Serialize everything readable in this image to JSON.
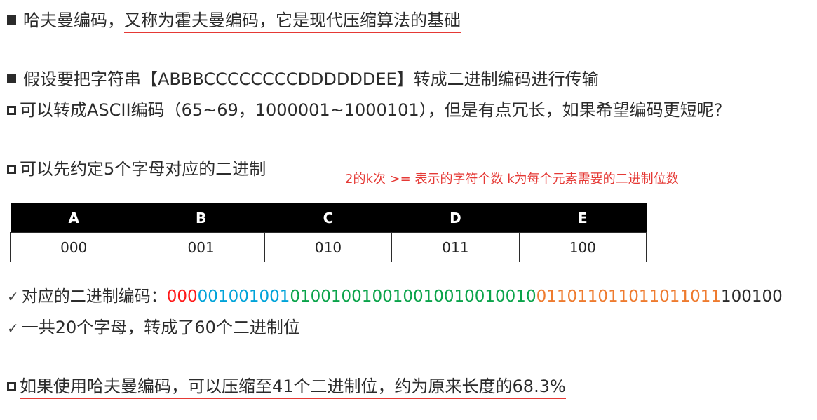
{
  "lines": {
    "l1": "哈夫曼编码，",
    "l1_underlined": "又称为霍夫曼编码，它是现代压缩算法的基础",
    "l2": "假设要把字符串【ABBBCCCCCCCCDDDDDDEE】转成二进制编码进行传输",
    "l3": "可以转成ASCII编码（65~69，1000001~1000101），但是有点冗长，如果希望编码更短呢?",
    "l4": "可以先约定5个字母对应的二进制",
    "note": "2的k次  >=  表示的字符个数   k为每个元素需要的二进制位数",
    "l5_label": "对应的二进制编码：",
    "l6": "一共20个字母，转成了60个二进制位",
    "l7": "如果使用哈夫曼编码，可以压缩至41个二进制位，约为原来长度的68.3%"
  },
  "table": {
    "headers": [
      "A",
      "B",
      "C",
      "D",
      "E"
    ],
    "codes": [
      "000",
      "001",
      "010",
      "011",
      "100"
    ]
  },
  "encoding": {
    "a": "000",
    "b": "001001001",
    "c": "010010010010010010010010",
    "d": "011011011011011011",
    "e": "100100"
  },
  "colors": {
    "A": "#ff1a1a",
    "B": "#00a3d9",
    "C": "#0aa34a",
    "D": "#ee7b2f",
    "E": "#2b2b2b",
    "underline": "#e53935",
    "note": "#e53935"
  }
}
